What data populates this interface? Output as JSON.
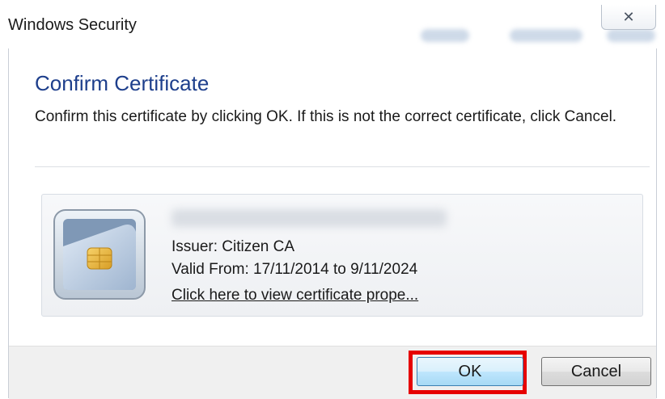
{
  "window": {
    "title": "Windows Security",
    "close_glyph": "✕"
  },
  "dialog": {
    "heading": "Confirm Certificate",
    "description": "Confirm this certificate by clicking OK. If this is not the correct certificate, click Cancel."
  },
  "certificate": {
    "icon": "smart-card-icon",
    "issuer": "Issuer: Citizen CA",
    "valid": "Valid From: 17/11/2014 to 9/11/2024",
    "link": "Click here to view certificate prope..."
  },
  "buttons": {
    "ok": "OK",
    "cancel": "Cancel"
  },
  "colors": {
    "heading": "#1e3f8c",
    "highlight": "#e60000"
  }
}
